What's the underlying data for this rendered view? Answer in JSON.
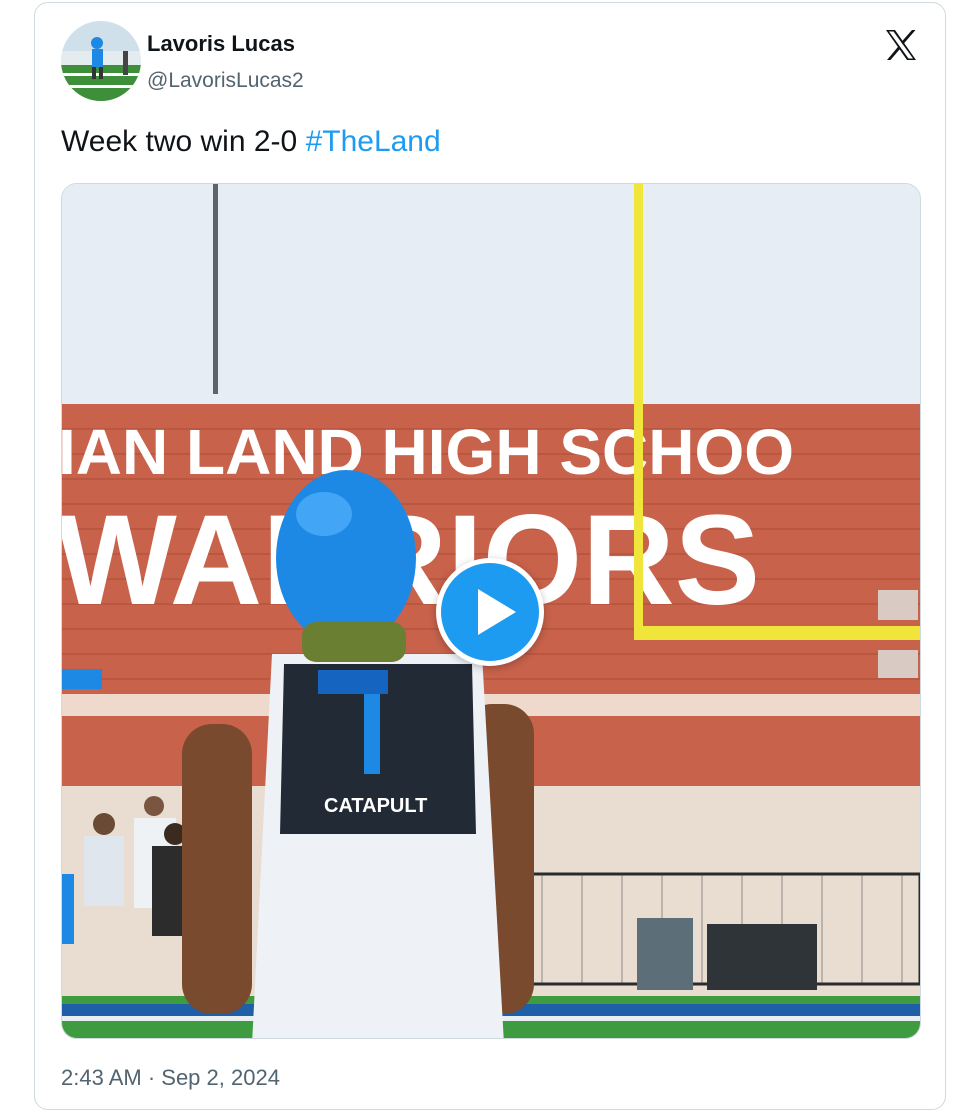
{
  "author": {
    "name": "Lavoris Lucas",
    "handle": "@LavorisLucas2"
  },
  "brand": {
    "icon": "x-logo-icon"
  },
  "tweet": {
    "text": "Week two win 2-0",
    "hashtag": "#TheLand",
    "timestamp": "2:43 AM · Sep 2, 2024"
  },
  "media": {
    "type": "video",
    "wall_sign_line1": "IAN LAND HIGH SCHOO",
    "wall_sign_line2": "WARRIORS",
    "shirt_text": "CATAPULT",
    "play_icon": "play-icon"
  },
  "colors": {
    "accent": "#1d9bf0",
    "text": "#0f1419",
    "muted": "#536471",
    "border": "#cfd9de"
  }
}
